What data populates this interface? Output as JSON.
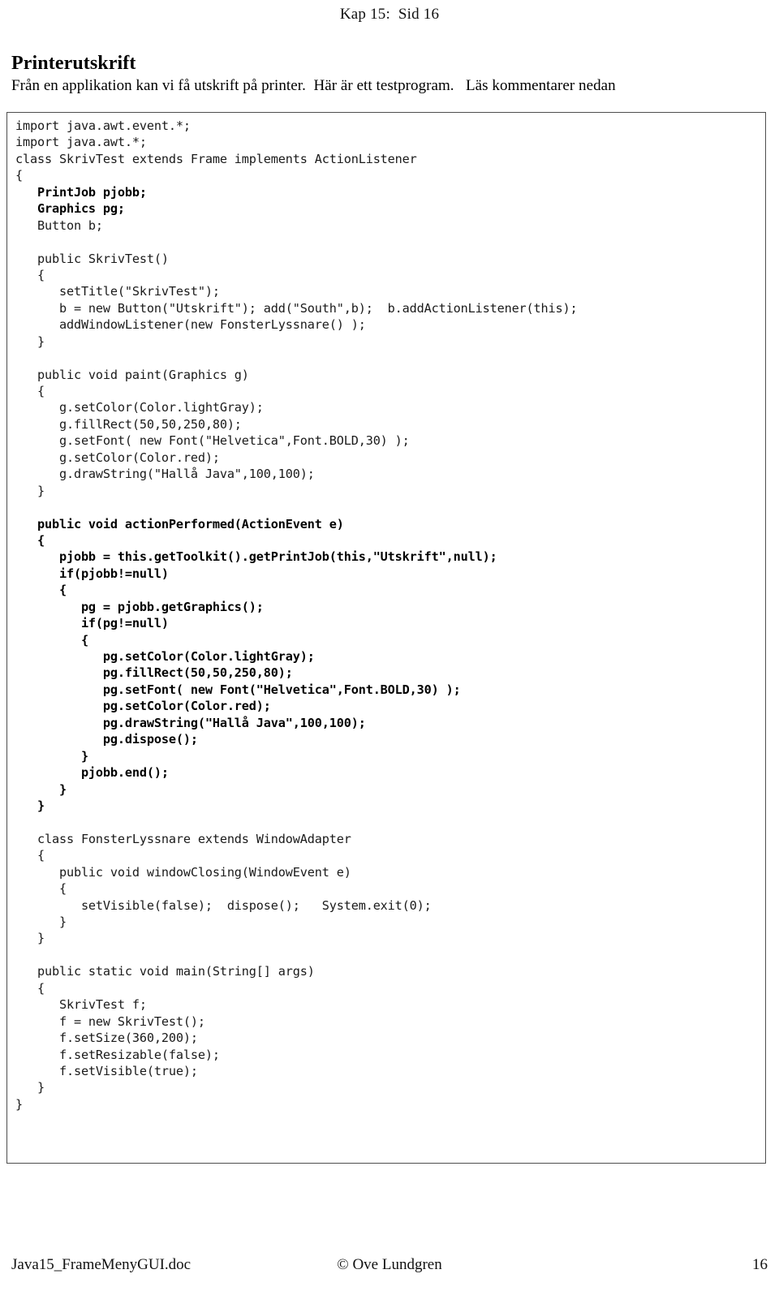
{
  "header": {
    "running_head": "Kap 15:  Sid 16"
  },
  "title_block": {
    "title": "Printerutskrift",
    "subtitle": "Från en applikation kan vi få utskrift på printer.  Här är ett testprogram.   Läs kommentarer nedan"
  },
  "code_block": {
    "language": "java",
    "border_color": "#4d4d4d",
    "lines": [
      {
        "text": "import java.awt.event.*;",
        "bold": false
      },
      {
        "text": "import java.awt.*;",
        "bold": false
      },
      {
        "text": "class SkrivTest extends Frame implements ActionListener",
        "bold": false
      },
      {
        "text": "{",
        "bold": false
      },
      {
        "text": "   PrintJob pjobb;",
        "bold": true
      },
      {
        "text": "   Graphics pg;",
        "bold": true
      },
      {
        "text": "   Button b;",
        "bold": false
      },
      {
        "text": "",
        "bold": false
      },
      {
        "text": "   public SkrivTest()",
        "bold": false
      },
      {
        "text": "   {",
        "bold": false
      },
      {
        "text": "      setTitle(\"SkrivTest\");",
        "bold": false
      },
      {
        "text": "      b = new Button(\"Utskrift\"); add(\"South\",b);  b.addActionListener(this);",
        "bold": false
      },
      {
        "text": "      addWindowListener(new FonsterLyssnare() );",
        "bold": false
      },
      {
        "text": "   }",
        "bold": false
      },
      {
        "text": "",
        "bold": false
      },
      {
        "text": "   public void paint(Graphics g)",
        "bold": false
      },
      {
        "text": "   {",
        "bold": false
      },
      {
        "text": "      g.setColor(Color.lightGray);",
        "bold": false
      },
      {
        "text": "      g.fillRect(50,50,250,80);",
        "bold": false
      },
      {
        "text": "      g.setFont( new Font(\"Helvetica\",Font.BOLD,30) );",
        "bold": false
      },
      {
        "text": "      g.setColor(Color.red);",
        "bold": false
      },
      {
        "text": "      g.drawString(\"Hallå Java\",100,100);",
        "bold": false
      },
      {
        "text": "   }",
        "bold": false
      },
      {
        "text": "",
        "bold": false
      },
      {
        "text": "   public void actionPerformed(ActionEvent e)",
        "bold": true
      },
      {
        "text": "   {",
        "bold": true
      },
      {
        "text": "      pjobb = this.getToolkit().getPrintJob(this,\"Utskrift\",null);",
        "bold": true
      },
      {
        "text": "      if(pjobb!=null)",
        "bold": true
      },
      {
        "text": "      {",
        "bold": true
      },
      {
        "text": "         pg = pjobb.getGraphics();",
        "bold": true
      },
      {
        "text": "         if(pg!=null)",
        "bold": true
      },
      {
        "text": "         {",
        "bold": true
      },
      {
        "text": "            pg.setColor(Color.lightGray);",
        "bold": true
      },
      {
        "text": "            pg.fillRect(50,50,250,80);",
        "bold": true
      },
      {
        "text": "            pg.setFont( new Font(\"Helvetica\",Font.BOLD,30) );",
        "bold": true
      },
      {
        "text": "            pg.setColor(Color.red);",
        "bold": true
      },
      {
        "text": "            pg.drawString(\"Hallå Java\",100,100);",
        "bold": true
      },
      {
        "text": "            pg.dispose();",
        "bold": true
      },
      {
        "text": "         }",
        "bold": true
      },
      {
        "text": "         pjobb.end();",
        "bold": true
      },
      {
        "text": "      }",
        "bold": true
      },
      {
        "text": "   }",
        "bold": true
      },
      {
        "text": "",
        "bold": false
      },
      {
        "text": "   class FonsterLyssnare extends WindowAdapter",
        "bold": false
      },
      {
        "text": "   {",
        "bold": false
      },
      {
        "text": "      public void windowClosing(WindowEvent e)",
        "bold": false
      },
      {
        "text": "      {",
        "bold": false
      },
      {
        "text": "         setVisible(false);  dispose();   System.exit(0);",
        "bold": false
      },
      {
        "text": "      }",
        "bold": false
      },
      {
        "text": "   }",
        "bold": false
      },
      {
        "text": "",
        "bold": false
      },
      {
        "text": "   public static void main(String[] args)",
        "bold": false
      },
      {
        "text": "   {",
        "bold": false
      },
      {
        "text": "      SkrivTest f;",
        "bold": false
      },
      {
        "text": "      f = new SkrivTest();",
        "bold": false
      },
      {
        "text": "      f.setSize(360,200);",
        "bold": false
      },
      {
        "text": "      f.setResizable(false);",
        "bold": false
      },
      {
        "text": "      f.setVisible(true);",
        "bold": false
      },
      {
        "text": "   }",
        "bold": false
      },
      {
        "text": "}",
        "bold": false
      }
    ]
  },
  "footer": {
    "left": "Java15_FrameMenyGUI.doc",
    "center": "© Ove Lundgren",
    "right": "16"
  }
}
